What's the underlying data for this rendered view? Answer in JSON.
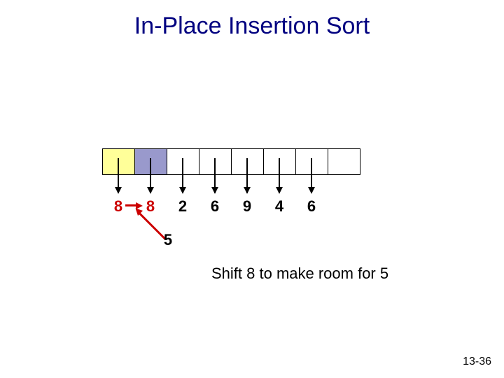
{
  "title": "In-Place Insertion Sort",
  "cells": [
    {
      "fill": "yellow"
    },
    {
      "fill": "purple"
    },
    {
      "fill": "white"
    },
    {
      "fill": "white"
    },
    {
      "fill": "white"
    },
    {
      "fill": "white"
    },
    {
      "fill": "white"
    },
    {
      "fill": "white"
    }
  ],
  "values": {
    "v0": "8",
    "v1": "8",
    "v2": "2",
    "v3": "6",
    "v4": "9",
    "v5": "4",
    "v6": "6"
  },
  "inserting": "5",
  "caption": "Shift 8 to make room for 5",
  "footer": "13-36",
  "chart_data": {
    "type": "table",
    "title": "In-Place Insertion Sort step",
    "array_display": [
      "8",
      "8",
      "2",
      "6",
      "9",
      "4",
      "6",
      ""
    ],
    "sorted_prefix_len": 1,
    "current_index": 1,
    "element_to_insert": 5,
    "action": "shift",
    "shift_from_index": 0,
    "shift_to_index": 1,
    "note": "Shift 8 to make room for 5"
  }
}
